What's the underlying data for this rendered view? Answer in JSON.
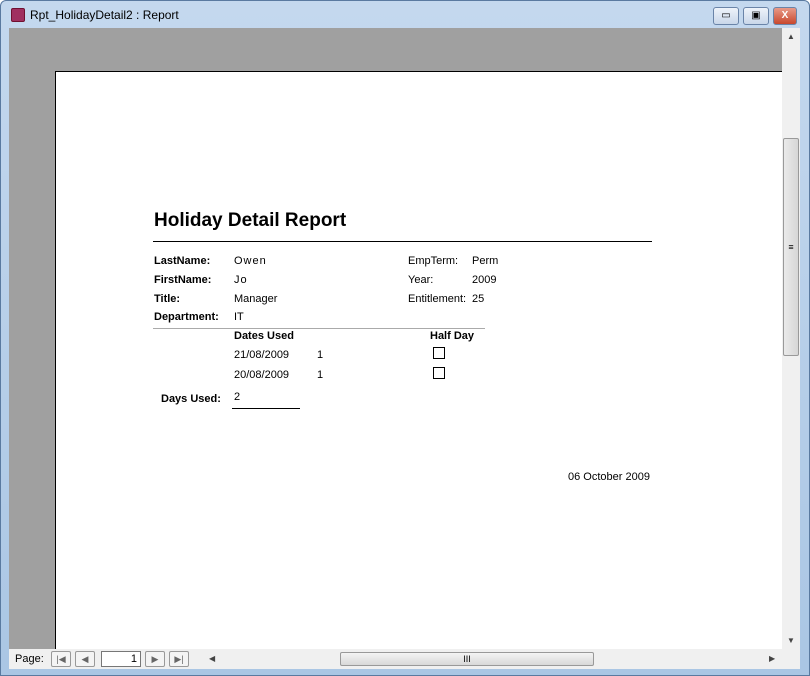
{
  "window": {
    "title": "Rpt_HolidayDetail2 : Report",
    "minimize": "▭",
    "restore": "▣",
    "close": "X"
  },
  "report": {
    "title": "Holiday Detail Report",
    "fields": {
      "last_name_label": "LastName:",
      "last_name": "Owen",
      "first_name_label": "FirstName:",
      "first_name": "Jo",
      "title_label": "Title:",
      "title": "Manager",
      "department_label": "Department:",
      "department": "IT",
      "emp_term_label": "EmpTerm:",
      "emp_term": "Perm",
      "year_label": "Year:",
      "year": "2009",
      "entitlement_label": "Entitlement:",
      "entitlement": "25"
    },
    "columns": {
      "dates_used": "Dates Used",
      "half_day": "Half Day"
    },
    "rows": [
      {
        "date": "21/08/2009",
        "days": "1",
        "half_day": false
      },
      {
        "date": "20/08/2009",
        "days": "1",
        "half_day": false
      }
    ],
    "days_used_label": "Days Used:",
    "days_used": "2",
    "footer_date": "06 October 2009"
  },
  "nav": {
    "page_label": "Page:",
    "page": "1",
    "first": "|◀",
    "prev": "◀",
    "next": "▶",
    "last": "▶|",
    "hgrip": "III",
    "vgrip": "≡"
  }
}
